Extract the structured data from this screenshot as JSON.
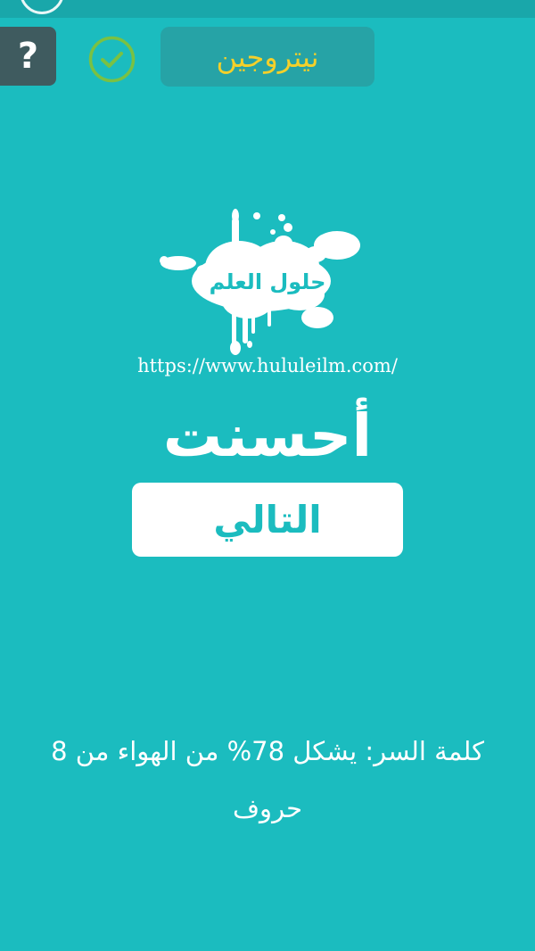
{
  "header": {
    "help_label": "?",
    "answer_word": "نيتروجين"
  },
  "logo": {
    "name": "حلول العلم"
  },
  "site_url": "https://www.hululeilm.com/",
  "result": {
    "title": "أحسنت"
  },
  "next_button": {
    "label": "التالي"
  },
  "clue": {
    "text": "كلمة السر: يشكل 78% من الهواء من 8 حروف"
  },
  "colors": {
    "background": "#1bbcbf",
    "answer_text": "#f4d02a",
    "check_green": "#7ac143",
    "help_bg": "#3f5b5f"
  }
}
